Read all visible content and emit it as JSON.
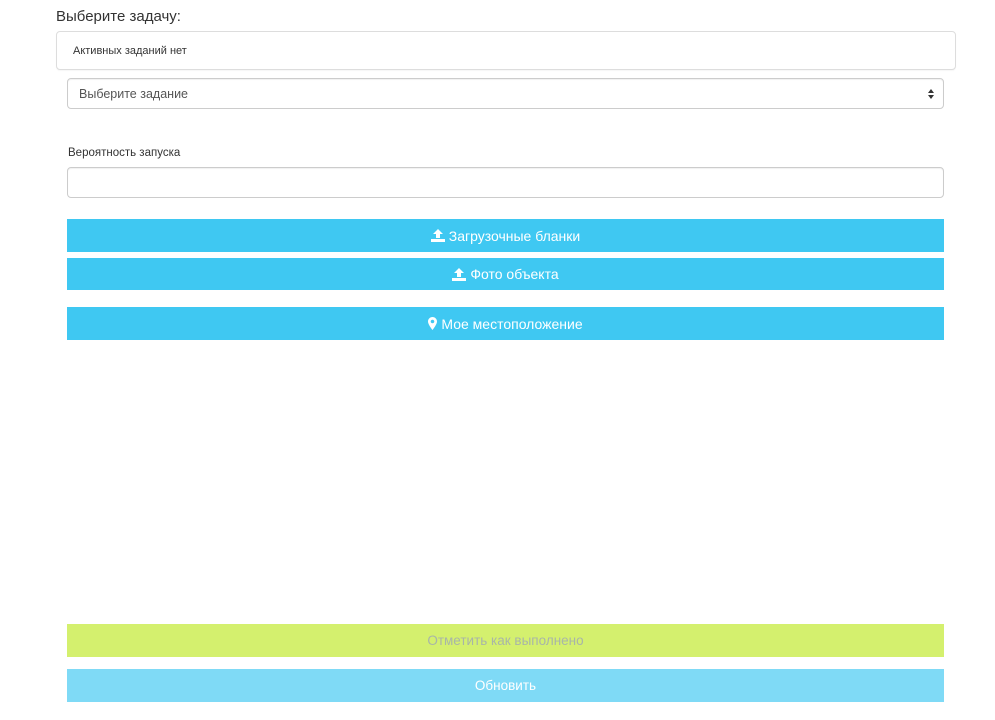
{
  "heading": "Выберите задачу:",
  "active_tasks": {
    "message": "Активных заданий нет"
  },
  "task_select": {
    "selected": "Выберите задание"
  },
  "launch_probability": {
    "label": "Вероятность запуска",
    "value": ""
  },
  "buttons": {
    "upload_forms": {
      "label": "Загрузочные бланки",
      "icon": "upload-icon"
    },
    "object_photo": {
      "label": "Фото объекта",
      "icon": "upload-icon"
    },
    "my_location": {
      "label": "Мое местоположение",
      "icon": "map-marker-icon"
    },
    "mark_done": {
      "label": "Отметить как выполнено"
    },
    "refresh": {
      "label": "Обновить"
    }
  },
  "colors": {
    "info_button": "#3fc8f2",
    "done_button": "#d4f06e",
    "refresh_button": "#7fdaf6"
  }
}
